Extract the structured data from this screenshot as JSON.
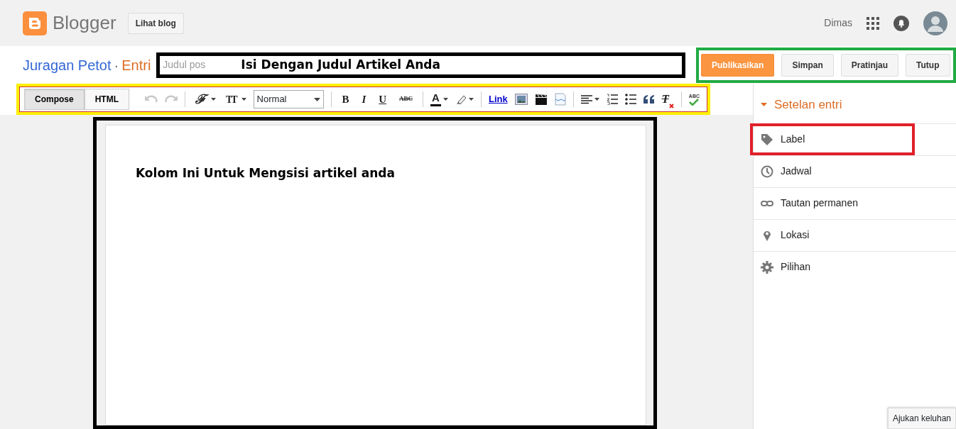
{
  "header": {
    "brand": "Blogger",
    "view_blog": "Lihat blog",
    "user": "Dimas"
  },
  "post_bar": {
    "blog_name": "Juragan Petot",
    "separator": "·",
    "section": "Entri",
    "title_field": {
      "placeholder": "Judul pos"
    },
    "title_note": "Isi Dengan Judul Artikel Anda",
    "actions": [
      {
        "label": "Publikasikan",
        "kind": "primary"
      },
      {
        "label": "Simpan",
        "kind": "default"
      },
      {
        "label": "Pratinjau",
        "kind": "default"
      },
      {
        "label": "Tutup",
        "kind": "default"
      }
    ],
    "annotation_frames": [
      {
        "kind": "title",
        "color": "#000000"
      },
      {
        "kind": "actions",
        "color": "#22aa44"
      },
      {
        "kind": "toolbar",
        "color": "#ffee00"
      },
      {
        "kind": "editor",
        "color": "#000000"
      },
      {
        "kind": "label-setting",
        "color": "#e0202a"
      }
    ]
  },
  "toolbar": {
    "modes": [
      {
        "label": "Compose",
        "selected": true
      },
      {
        "label": "HTML",
        "selected": false
      }
    ],
    "items": [
      {
        "kind": "undo",
        "disabled": true
      },
      {
        "kind": "redo",
        "disabled": true
      },
      {
        "kind": "separator"
      },
      {
        "kind": "font-menu",
        "text": "ℱ"
      },
      {
        "kind": "size-menu",
        "text": "TT"
      },
      {
        "kind": "select",
        "text": "Normal"
      },
      {
        "kind": "separator"
      },
      {
        "kind": "bold",
        "text": "B"
      },
      {
        "kind": "italic",
        "text": "I"
      },
      {
        "kind": "underline",
        "text": "U"
      },
      {
        "kind": "strike",
        "text": "ABC"
      },
      {
        "kind": "separator"
      },
      {
        "kind": "text-color",
        "text": "A"
      },
      {
        "kind": "highlight-color"
      },
      {
        "kind": "separator"
      },
      {
        "kind": "link",
        "text": "Link"
      },
      {
        "kind": "image"
      },
      {
        "kind": "video"
      },
      {
        "kind": "jump-break"
      },
      {
        "kind": "separator"
      },
      {
        "kind": "align"
      },
      {
        "kind": "numbered-list"
      },
      {
        "kind": "bullet-list"
      },
      {
        "kind": "quote"
      },
      {
        "kind": "clear-format",
        "text": "T"
      },
      {
        "kind": "separator"
      },
      {
        "kind": "spellcheck",
        "text": "ABC"
      }
    ]
  },
  "editor": {
    "note": "Kolom Ini Untuk Mengsisi artikel anda"
  },
  "sidebar": {
    "title": "Setelan entri",
    "items": [
      {
        "kind": "label",
        "label": "Label"
      },
      {
        "kind": "schedule",
        "label": "Jadwal"
      },
      {
        "kind": "permalink",
        "label": "Tautan permanen"
      },
      {
        "kind": "location",
        "label": "Lokasi"
      },
      {
        "kind": "options",
        "label": "Pilihan"
      }
    ]
  },
  "feedback": "Ajukan keluhan"
}
